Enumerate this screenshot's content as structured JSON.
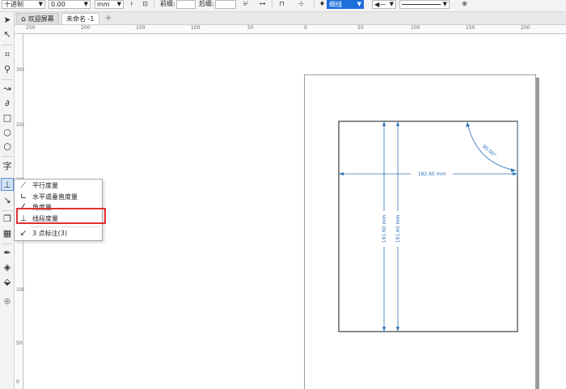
{
  "property_bar": {
    "units_mode": "十进制",
    "precision": "0.00",
    "units": "mm",
    "prefix_label": "前缀:",
    "suffix_label": "后缀:",
    "outline_style": "细线"
  },
  "tabs": [
    {
      "label": "欢迎屏幕"
    },
    {
      "label": "未命名 -1"
    }
  ],
  "ruler": {
    "h_ticks": [
      "250",
      "200",
      "150",
      "100",
      "50",
      "0",
      "50",
      "100",
      "150",
      "200"
    ],
    "v_ticks": [
      "300",
      "250",
      "200",
      "150",
      "100",
      "50",
      "0"
    ]
  },
  "flyout": {
    "items": [
      {
        "label": "平行度量"
      },
      {
        "label": "水平或垂直度量"
      },
      {
        "label": "角度量"
      },
      {
        "label": "线段度量"
      },
      {
        "label": "3 点标注(3)"
      }
    ]
  },
  "drawing": {
    "h_dim": "182.65 mm",
    "v_dim_1": "191.60 mm",
    "v_dim_2": "191.60 mm",
    "angle_dim": "90.00°"
  },
  "colors": {
    "dimension": "#2e73b8",
    "highlight": "#e03131"
  }
}
